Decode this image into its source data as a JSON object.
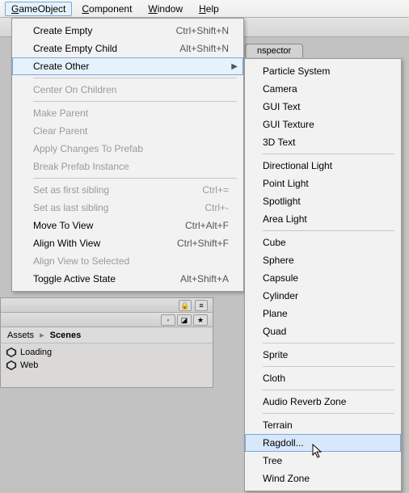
{
  "menubar": {
    "items": [
      {
        "label": "GameObject",
        "mn": "G",
        "open": true
      },
      {
        "label": "Component",
        "mn": "C"
      },
      {
        "label": "Window",
        "mn": "W"
      },
      {
        "label": "Help",
        "mn": "H"
      }
    ]
  },
  "inspector_tab": "nspector",
  "menu1": {
    "groups": [
      [
        {
          "label": "Create Empty",
          "shortcut": "Ctrl+Shift+N"
        },
        {
          "label": "Create Empty Child",
          "shortcut": "Alt+Shift+N"
        },
        {
          "label": "Create Other",
          "shortcut": "",
          "submenu": true,
          "hover": true
        }
      ],
      [
        {
          "label": "Center On Children",
          "disabled": true
        }
      ],
      [
        {
          "label": "Make Parent",
          "disabled": true
        },
        {
          "label": "Clear Parent",
          "disabled": true
        },
        {
          "label": "Apply Changes To Prefab",
          "disabled": true
        },
        {
          "label": "Break Prefab Instance",
          "disabled": true
        }
      ],
      [
        {
          "label": "Set as first sibling",
          "shortcut": "Ctrl+=",
          "disabled": true
        },
        {
          "label": "Set as last sibling",
          "shortcut": "Ctrl+-",
          "disabled": true
        },
        {
          "label": "Move To View",
          "shortcut": "Ctrl+Alt+F"
        },
        {
          "label": "Align With View",
          "shortcut": "Ctrl+Shift+F"
        },
        {
          "label": "Align View to Selected",
          "disabled": true
        },
        {
          "label": "Toggle Active State",
          "shortcut": "Alt+Shift+A"
        }
      ]
    ]
  },
  "menu2": {
    "groups": [
      [
        "Particle System",
        "Camera",
        "GUI Text",
        "GUI Texture",
        "3D Text"
      ],
      [
        "Directional Light",
        "Point Light",
        "Spotlight",
        "Area Light"
      ],
      [
        "Cube",
        "Sphere",
        "Capsule",
        "Cylinder",
        "Plane",
        "Quad"
      ],
      [
        "Sprite"
      ],
      [
        "Cloth"
      ],
      [
        "Audio Reverb Zone"
      ],
      [
        "Terrain",
        "Ragdoll...",
        "Tree",
        "Wind Zone"
      ]
    ],
    "highlighted": "Ragdoll..."
  },
  "project": {
    "breadcrumb": [
      "Assets",
      "Scenes"
    ],
    "items": [
      "Loading",
      "Web"
    ]
  }
}
